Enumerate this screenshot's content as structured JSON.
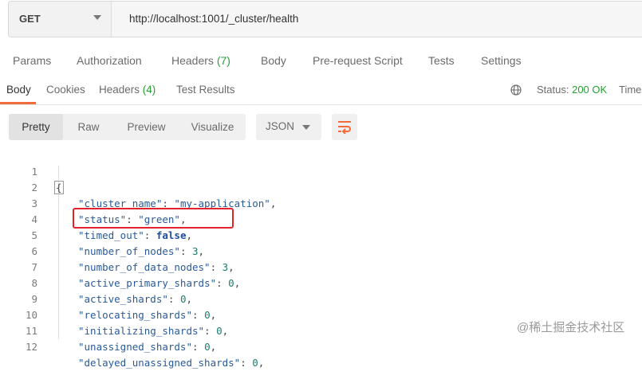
{
  "request": {
    "method": "GET",
    "url": "http://localhost:1001/_cluster/health"
  },
  "request_tabs": [
    {
      "label": "Params"
    },
    {
      "label": "Authorization"
    },
    {
      "label": "Headers",
      "count": "(7)"
    },
    {
      "label": "Body"
    },
    {
      "label": "Pre-request Script"
    },
    {
      "label": "Tests"
    },
    {
      "label": "Settings"
    }
  ],
  "response_tabs": [
    {
      "label": "Body",
      "active": true
    },
    {
      "label": "Cookies"
    },
    {
      "label": "Headers",
      "count": "(4)"
    },
    {
      "label": "Test Results"
    }
  ],
  "status": {
    "label": "Status:",
    "value": "200 OK"
  },
  "time": {
    "label": "Time"
  },
  "view_modes": [
    {
      "label": "Pretty",
      "active": true
    },
    {
      "label": "Raw"
    },
    {
      "label": "Preview"
    },
    {
      "label": "Visualize"
    }
  ],
  "format": {
    "selected": "JSON"
  },
  "code_lines": [
    {
      "n": "1",
      "open": "{"
    },
    {
      "n": "2",
      "key": "\"cluster_name\"",
      "value": "\"my-application\"",
      "kind": "string"
    },
    {
      "n": "3",
      "key": "\"status\"",
      "value": "\"green\"",
      "kind": "string"
    },
    {
      "n": "4",
      "key": "\"timed_out\"",
      "value": "false",
      "kind": "bool"
    },
    {
      "n": "5",
      "key": "\"number_of_nodes\"",
      "value": "3",
      "kind": "number"
    },
    {
      "n": "6",
      "key": "\"number_of_data_nodes\"",
      "value": "3",
      "kind": "number"
    },
    {
      "n": "7",
      "key": "\"active_primary_shards\"",
      "value": "0",
      "kind": "number"
    },
    {
      "n": "8",
      "key": "\"active_shards\"",
      "value": "0",
      "kind": "number"
    },
    {
      "n": "9",
      "key": "\"relocating_shards\"",
      "value": "0",
      "kind": "number"
    },
    {
      "n": "10",
      "key": "\"initializing_shards\"",
      "value": "0",
      "kind": "number"
    },
    {
      "n": "11",
      "key": "\"unassigned_shards\"",
      "value": "0",
      "kind": "number"
    },
    {
      "n": "12",
      "key": "\"delayed_unassigned_shards\"",
      "value": "0",
      "kind": "number"
    }
  ],
  "highlighted_line": "5",
  "watermark": "@稀土掘金技术社区",
  "colors": {
    "accent": "#f26b3a",
    "success": "#26a035",
    "highlight": "#e0242a",
    "json_key": "#2a5a9a",
    "json_number": "#1a7d6e",
    "json_bool": "#1a4fa0"
  },
  "icons": {
    "method_dropdown": "chevron-down-icon",
    "status": "globe-icon",
    "format_dropdown": "chevron-down-icon",
    "wrap": "wrap-lines-icon"
  }
}
